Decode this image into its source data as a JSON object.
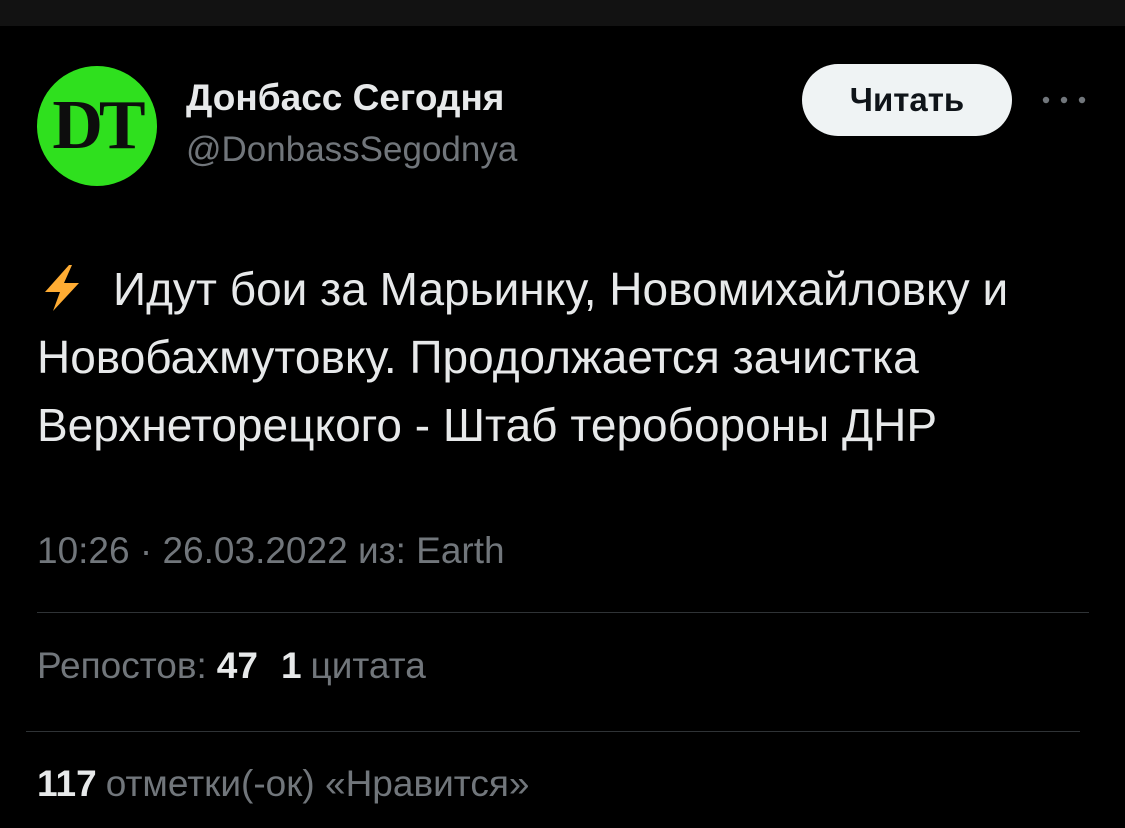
{
  "author": {
    "display_name": "Донбасс Сегодня",
    "handle": "@DonbassSegodnya",
    "avatar_text": "DT",
    "avatar_color": "#2fe01e"
  },
  "follow_button": {
    "label": "Читать"
  },
  "more_button": {
    "icon": "more-horizontal-icon"
  },
  "tweet": {
    "emoji_icon": "lightning-bolt-icon",
    "lines": [
      "Идут бои за Марьинку, Новомихайловку и",
      "Новобахмутовку. Продолжается зачистка",
      "Верхнеторецкого - Штаб теробороны ДНР"
    ]
  },
  "meta": {
    "time": "10:26",
    "separator": "·",
    "date": "26.03.2022",
    "source_prefix": "из:",
    "source": "Earth"
  },
  "stats": {
    "reposts_label": "Репостов:",
    "reposts_count": "47",
    "quotes_count": "1",
    "quotes_label": "цитата",
    "likes_count": "117",
    "likes_label": "отметки(-ок) «Нравится»"
  },
  "colors": {
    "background": "#000000",
    "text_primary": "#e7e9ea",
    "text_secondary": "#71767b",
    "divider": "#2f3336",
    "button_bg": "#eff3f4",
    "bolt": "#ffac33"
  }
}
